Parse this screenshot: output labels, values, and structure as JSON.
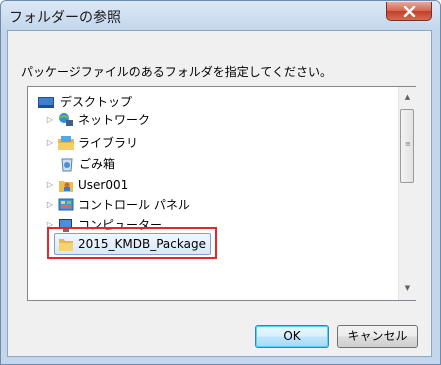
{
  "window": {
    "title": "フォルダーの参照"
  },
  "description": "パッケージファイルのあるフォルダを指定してください。",
  "tree": {
    "items": [
      {
        "label": "デスクトップ",
        "icon": "desktop-icon",
        "expander": ""
      },
      {
        "label": "ネットワーク",
        "icon": "network-icon",
        "expander": "▷"
      },
      {
        "label": "ライブラリ",
        "icon": "library-icon",
        "expander": "▷"
      },
      {
        "label": "ごみ箱",
        "icon": "recycle-bin-icon",
        "expander": ""
      },
      {
        "label": "User001",
        "icon": "user-folder-icon",
        "expander": "▷"
      },
      {
        "label": "コントロール パネル",
        "icon": "control-panel-icon",
        "expander": "▷"
      },
      {
        "label": "コンピューター",
        "icon": "computer-icon",
        "expander": "▷"
      },
      {
        "label": "2015_KMDB_Package",
        "icon": "folder-icon",
        "expander": ""
      }
    ],
    "selected_index": 7
  },
  "buttons": {
    "ok": "OK",
    "cancel": "キャンセル"
  },
  "colors": {
    "highlight": "#e0282e",
    "selection": "#d9e8fb",
    "close": "#c1402b"
  }
}
